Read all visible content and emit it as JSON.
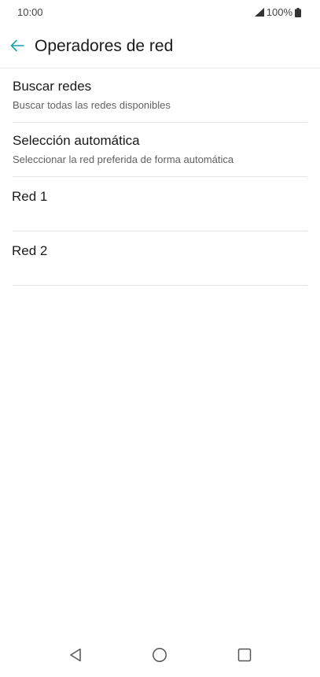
{
  "status_bar": {
    "time": "10:00",
    "battery": "100%",
    "icons": [
      "signal-icon",
      "battery-icon"
    ]
  },
  "header": {
    "title": "Operadores de red",
    "back_icon": "arrow-left-icon",
    "accent_color": "#1aa0a8"
  },
  "list": {
    "items": [
      {
        "title": "Buscar redes",
        "subtitle": "Buscar todas las redes disponibles"
      },
      {
        "title": "Selección automática",
        "subtitle": "Seleccionar la red preferida de forma automática"
      },
      {
        "title": "Red 1"
      },
      {
        "title": "Red 2"
      }
    ]
  },
  "nav_bar": {
    "icons": [
      "nav-back-icon",
      "nav-home-icon",
      "nav-recents-icon"
    ]
  }
}
